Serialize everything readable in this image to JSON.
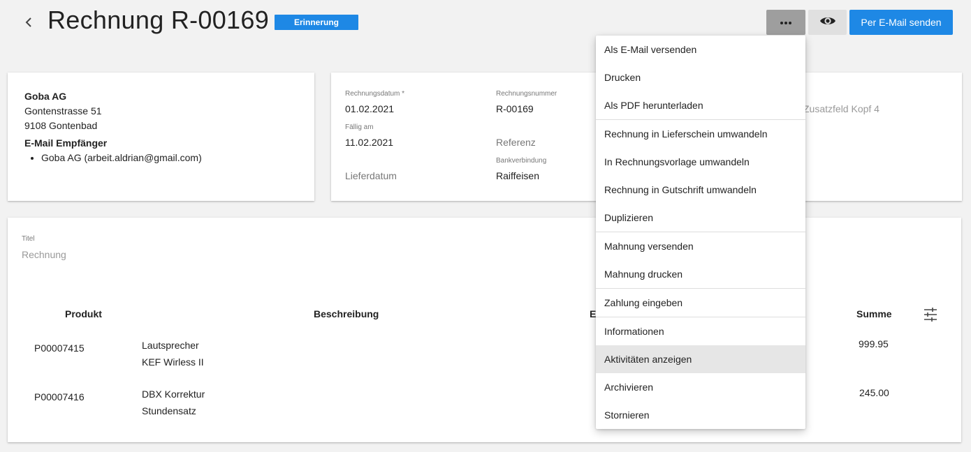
{
  "header": {
    "title": "Rechnung R-00169",
    "status_badge": "Erinnerung",
    "email_button": "Per E-Mail senden"
  },
  "customer": {
    "name": "Goba AG",
    "street": "Gontenstrasse 51",
    "city": "9108 Gontenbad",
    "recipients_heading": "E-Mail Empfänger",
    "recipients": [
      "Goba AG (arbeit.aldrian@gmail.com)"
    ]
  },
  "details": {
    "invoice_date_label": "Rechnungsdatum *",
    "invoice_date": "01.02.2021",
    "invoice_number_label": "Rechnungsnummer",
    "invoice_number": "R-00169",
    "due_label": "Fällig am",
    "due_date": "11.02.2021",
    "reference_placeholder": "Referenz",
    "bank_label": "Bankverbindung",
    "bank_value": "Raiffeisen",
    "delivery_placeholder": "Lieferdatum",
    "extra_field_4": "Zusatzfeld Kopf 4"
  },
  "items": {
    "title_label": "Titel",
    "title_placeholder": "Rechnung",
    "columns": {
      "product": "Produkt",
      "description": "Beschreibung",
      "partial": "E",
      "sum": "Summe"
    },
    "rows": [
      {
        "product": "P00007415",
        "desc_line1": "Lautsprecher",
        "desc_line2": "KEF Wirless II",
        "sum": "999.95"
      },
      {
        "product": "P00007416",
        "desc_line1": "DBX Korrektur",
        "desc_line2": "Stundensatz",
        "sum": "245.00"
      }
    ]
  },
  "menu": {
    "groups": [
      [
        "Als E-Mail versenden",
        "Drucken",
        "Als PDF herunterladen"
      ],
      [
        "Rechnung in Lieferschein umwandeln",
        "In Rechnungsvorlage umwandeln",
        "Rechnung in Gutschrift umwandeln",
        "Duplizieren"
      ],
      [
        "Mahnung versenden",
        "Mahnung drucken"
      ],
      [
        "Zahlung eingeben"
      ],
      [
        "Informationen",
        "Aktivitäten anzeigen",
        "Archivieren",
        "Stornieren"
      ]
    ],
    "highlighted": "Aktivitäten anzeigen"
  },
  "icons": {
    "back": "chevron-left-icon",
    "more": "more-horizontal-icon",
    "preview": "eye-icon",
    "columns": "tune-icon"
  },
  "colors": {
    "accent": "#1e88e5",
    "more_button_bg": "#9e9e9e",
    "preview_button_bg": "#e0e0e0",
    "page_bg": "#f2f2f2"
  }
}
